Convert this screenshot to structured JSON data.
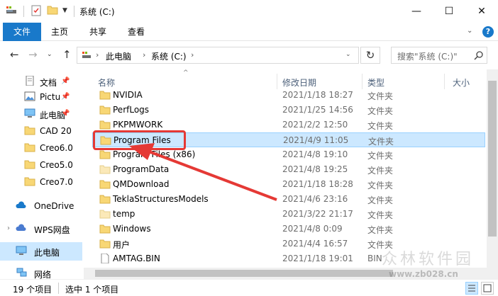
{
  "window": {
    "title": "系统 (C:)",
    "minimize": "—",
    "maximize": "☐",
    "close": "✕"
  },
  "ribbon": {
    "tabs": [
      "文件",
      "主页",
      "共享",
      "查看"
    ],
    "help": "?"
  },
  "address_bar": {
    "crumbs": [
      "此电脑",
      "系统 (C:)"
    ],
    "search_placeholder": "搜索\"系统 (C:)\""
  },
  "nav_pane": {
    "items": [
      {
        "label": "文档",
        "icon": "document-icon",
        "pinned": true
      },
      {
        "label": "Pictu",
        "icon": "pictures-icon",
        "pinned": true
      },
      {
        "label": "此电脑",
        "icon": "pc-icon",
        "pinned": true
      },
      {
        "label": "CAD 20",
        "icon": "folder-icon",
        "pinned": false
      },
      {
        "label": "Creo6.0",
        "icon": "folder-icon",
        "pinned": false
      },
      {
        "label": "Creo5.0",
        "icon": "folder-icon",
        "pinned": false
      },
      {
        "label": "Creo7.0",
        "icon": "folder-icon",
        "pinned": false
      },
      {
        "label": "OneDrive",
        "icon": "cloud-icon",
        "pinned": false
      },
      {
        "label": "WPS网盘",
        "icon": "wps-cloud-icon",
        "pinned": false
      },
      {
        "label": "此电脑",
        "icon": "pc-icon",
        "pinned": false,
        "selected": true
      },
      {
        "label": "网络",
        "icon": "network-icon",
        "pinned": false
      }
    ]
  },
  "file_list": {
    "columns": [
      "名称",
      "修改日期",
      "类型",
      "大小"
    ],
    "rows": [
      {
        "name": "NVIDIA",
        "date": "2021/1/18 18:27",
        "type": "文件夹",
        "icon": "folder-icon"
      },
      {
        "name": "PerfLogs",
        "date": "2021/1/25 14:56",
        "type": "文件夹",
        "icon": "folder-icon"
      },
      {
        "name": "PKPMWORK",
        "date": "2021/2/2 12:50",
        "type": "文件夹",
        "icon": "folder-icon"
      },
      {
        "name": "Program Files",
        "date": "2021/4/9 11:05",
        "type": "文件夹",
        "icon": "folder-icon",
        "selected": true
      },
      {
        "name": "Program Files (x86)",
        "date": "2021/4/8 19:10",
        "type": "文件夹",
        "icon": "folder-icon"
      },
      {
        "name": "ProgramData",
        "date": "2021/4/8 19:25",
        "type": "文件夹",
        "icon": "folder-hidden-icon"
      },
      {
        "name": "QMDownload",
        "date": "2021/1/18 18:28",
        "type": "文件夹",
        "icon": "folder-icon"
      },
      {
        "name": "TeklaStructuresModels",
        "date": "2021/4/6 23:16",
        "type": "文件夹",
        "icon": "folder-icon"
      },
      {
        "name": "temp",
        "date": "2021/3/22 21:17",
        "type": "文件夹",
        "icon": "folder-hidden-icon"
      },
      {
        "name": "Windows",
        "date": "2021/4/8 0:09",
        "type": "文件夹",
        "icon": "folder-icon"
      },
      {
        "name": "用户",
        "date": "2021/4/4 16:57",
        "type": "文件夹",
        "icon": "folder-icon"
      },
      {
        "name": "AMTAG.BIN",
        "date": "2021/1/18 19:01",
        "type": "BIN",
        "icon": "file-icon"
      }
    ]
  },
  "status_bar": {
    "item_count": "19 个项目",
    "selected": "选中 1 个项目"
  },
  "watermark": {
    "text": "众林软件园",
    "url": "www.zb028.cn"
  },
  "colors": {
    "accent": "#1979ca",
    "selection": "#cce8ff",
    "annotation": "#e53935",
    "folder": "#f8d775"
  }
}
